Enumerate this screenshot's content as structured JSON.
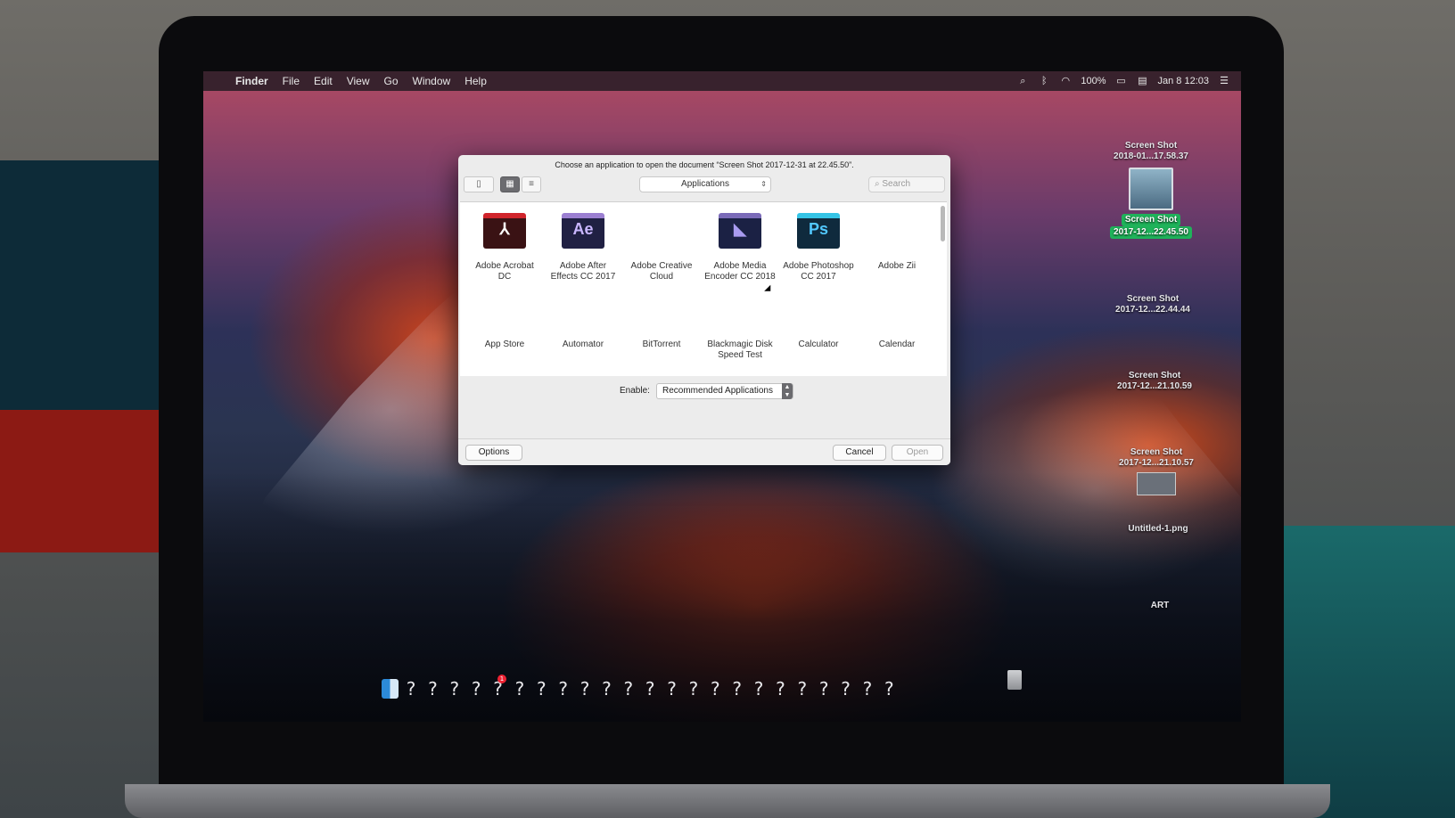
{
  "menubar": {
    "app": "Finder",
    "items": [
      "File",
      "Edit",
      "View",
      "Go",
      "Window",
      "Help"
    ],
    "battery": "100%",
    "datetime": "Jan 8  12:03"
  },
  "desktop": {
    "icons": [
      {
        "line1": "Screen Shot",
        "line2": "2018-01...17.58.37"
      },
      {
        "line1": "Screen Shot",
        "line2": "2017-12...22.45.50"
      },
      {
        "line1": "Screen Shot",
        "line2": "2017-12...22.44.44"
      },
      {
        "line1": "Screen Shot",
        "line2": "2017-12...21.10.59"
      },
      {
        "line1": "Screen Shot",
        "line2": "2017-12...21.10.57"
      },
      {
        "line1": "Untitled-1.png"
      },
      {
        "line1": "ART"
      }
    ]
  },
  "dialog": {
    "title": "Choose an application to open the document “Screen Shot 2017-12-31 at 22.45.50”.",
    "location": "Applications",
    "search_placeholder": "Search",
    "apps": [
      {
        "line1": "Adobe Acrobat",
        "line2": "DC",
        "glyph": "⅄"
      },
      {
        "line1": "Adobe After",
        "line2": "Effects CC 2017",
        "glyph": "Ae"
      },
      {
        "line1": "Adobe Creative",
        "line2": "Cloud",
        "glyph": ""
      },
      {
        "line1": "Adobe Media",
        "line2": "Encoder CC 2018",
        "glyph": "◣"
      },
      {
        "line1": "Adobe Photoshop",
        "line2": "CC 2017",
        "glyph": "Ps"
      },
      {
        "line1": "Adobe Zii",
        "line2": "",
        "glyph": ""
      },
      {
        "line1": "App Store",
        "line2": ""
      },
      {
        "line1": "Automator",
        "line2": ""
      },
      {
        "line1": "BitTorrent",
        "line2": ""
      },
      {
        "line1": "Blackmagic Disk",
        "line2": "Speed Test"
      },
      {
        "line1": "Calculator",
        "line2": ""
      },
      {
        "line1": "Calendar",
        "line2": ""
      }
    ],
    "enable_label": "Enable:",
    "enable_value": "Recommended Applications",
    "options_label": "Options",
    "cancel_label": "Cancel",
    "open_label": "Open"
  },
  "dock": {
    "placeholder_glyph": "?",
    "badge": "1"
  }
}
